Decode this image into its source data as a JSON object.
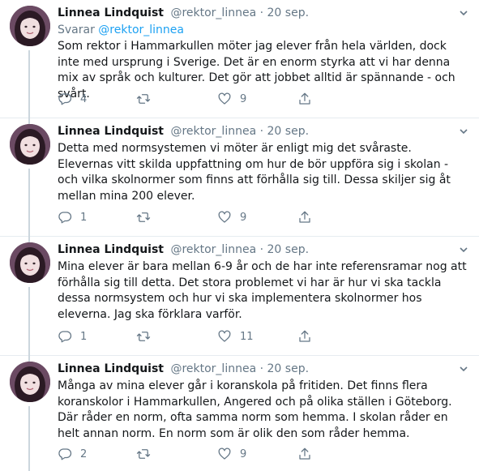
{
  "colors": {
    "link": "#1da1f2",
    "muted": "#657786",
    "text": "#14171a",
    "divider": "#e6ecf0"
  },
  "icons": [
    "reply-icon",
    "retweet-icon",
    "like-icon",
    "share-icon",
    "caret-down-icon"
  ],
  "tweets": [
    {
      "name": "Linnea Lindquist",
      "handle": "@rektor_linnea",
      "dot": "·",
      "date": "20 sep.",
      "replying_prefix": "Svarar",
      "replying_to": "@rektor_linnea",
      "text": "Som rektor i Hammarkullen möter jag elever från hela världen, dock inte med ursprung i Sverige. Det är en enorm styrka att vi har denna mix av språk och kulturer. Det gör att jobbet alltid är spännande - och svårt.",
      "replies": "4",
      "retweets": "",
      "likes": "9"
    },
    {
      "name": "Linnea Lindquist",
      "handle": "@rektor_linnea",
      "dot": "·",
      "date": "20 sep.",
      "text": "Detta med normsystemen vi möter är enligt mig det svåraste. Elevernas vitt skilda uppfattning om hur de bör uppföra sig i skolan - och vilka skolnormer som finns att förhålla sig till. Dessa skiljer sig åt mellan mina 200 elever.",
      "replies": "1",
      "retweets": "",
      "likes": "9"
    },
    {
      "name": "Linnea Lindquist",
      "handle": "@rektor_linnea",
      "dot": "·",
      "date": "20 sep.",
      "text": "Mina elever är bara mellan 6-9 år och de har inte referensramar nog att förhålla sig till detta. Det stora problemet vi har är hur vi ska tackla dessa normsystem och hur vi ska implementera skolnormer hos eleverna. Jag ska förklara varför.",
      "replies": "1",
      "retweets": "",
      "likes": "11"
    },
    {
      "name": "Linnea Lindquist",
      "handle": "@rektor_linnea",
      "dot": "·",
      "date": "20 sep.",
      "text": "Många av mina elever går i koranskola på fritiden. Det finns flera koranskolor i Hammarkullen, Angered och på olika ställen i Göteborg. Där råder en norm, ofta samma norm som hemma. I skolan råder en helt annan norm. En norm som är olik den som råder hemma.",
      "replies": "2",
      "retweets": "",
      "likes": "9"
    }
  ]
}
